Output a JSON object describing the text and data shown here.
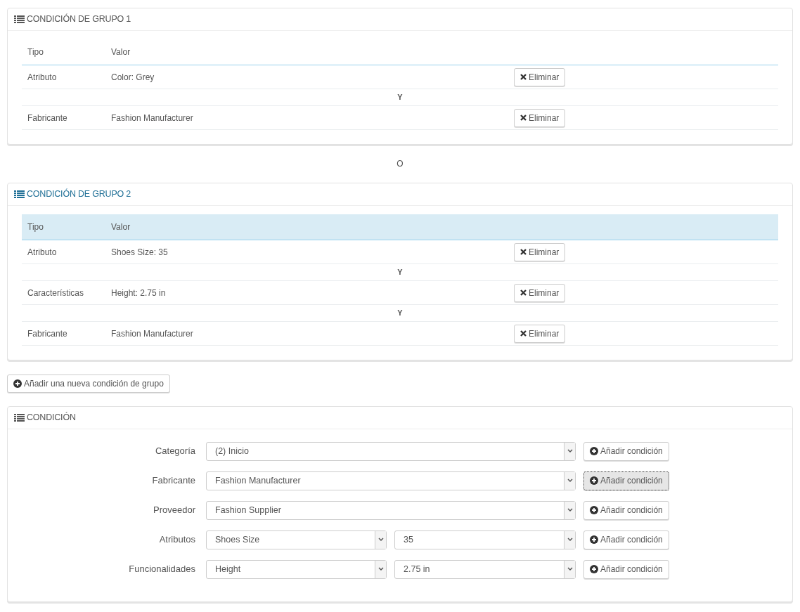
{
  "groups": [
    {
      "title": "CONDICIÓN DE GRUPO 1",
      "selected": false,
      "columns": [
        "Tipo",
        "Valor"
      ],
      "items": [
        {
          "kind": "condition",
          "type": "Atributo",
          "value": "Color: Grey",
          "button": "Eliminar"
        },
        {
          "kind": "connector",
          "text": "Y"
        },
        {
          "kind": "condition",
          "type": "Fabricante",
          "value": "Fashion Manufacturer",
          "button": "Eliminar"
        }
      ]
    },
    {
      "kind": "separator",
      "text": "O"
    },
    {
      "title": "CONDICIÓN DE GRUPO 2",
      "selected": true,
      "columns": [
        "Tipo",
        "Valor"
      ],
      "items": [
        {
          "kind": "condition",
          "type": "Atributo",
          "value": "Shoes Size: 35",
          "button": "Eliminar"
        },
        {
          "kind": "connector",
          "text": "Y"
        },
        {
          "kind": "condition",
          "type": "Características",
          "value": "Height: 2.75 in",
          "button": "Eliminar"
        },
        {
          "kind": "connector",
          "text": "Y"
        },
        {
          "kind": "condition",
          "type": "Fabricante",
          "value": "Fashion Manufacturer",
          "button": "Eliminar"
        }
      ]
    }
  ],
  "add_group_button": "Añadir una nueva condición de grupo",
  "condition_panel": {
    "title": "CONDICIÓN",
    "rows": [
      {
        "label": "Categoría",
        "selects": [
          "(2) Inicio"
        ],
        "button": "Añadir condición",
        "focused": false
      },
      {
        "label": "Fabricante",
        "selects": [
          "Fashion Manufacturer"
        ],
        "button": "Añadir condición",
        "focused": true
      },
      {
        "label": "Proveedor",
        "selects": [
          "Fashion Supplier"
        ],
        "button": "Añadir condición",
        "focused": false
      },
      {
        "label": "Atributos",
        "selects": [
          "Shoes Size",
          "35"
        ],
        "button": "Añadir condición",
        "focused": false
      },
      {
        "label": "Funcionalidades",
        "selects": [
          "Height",
          "2.75 in"
        ],
        "button": "Añadir condición",
        "focused": false
      }
    ]
  }
}
